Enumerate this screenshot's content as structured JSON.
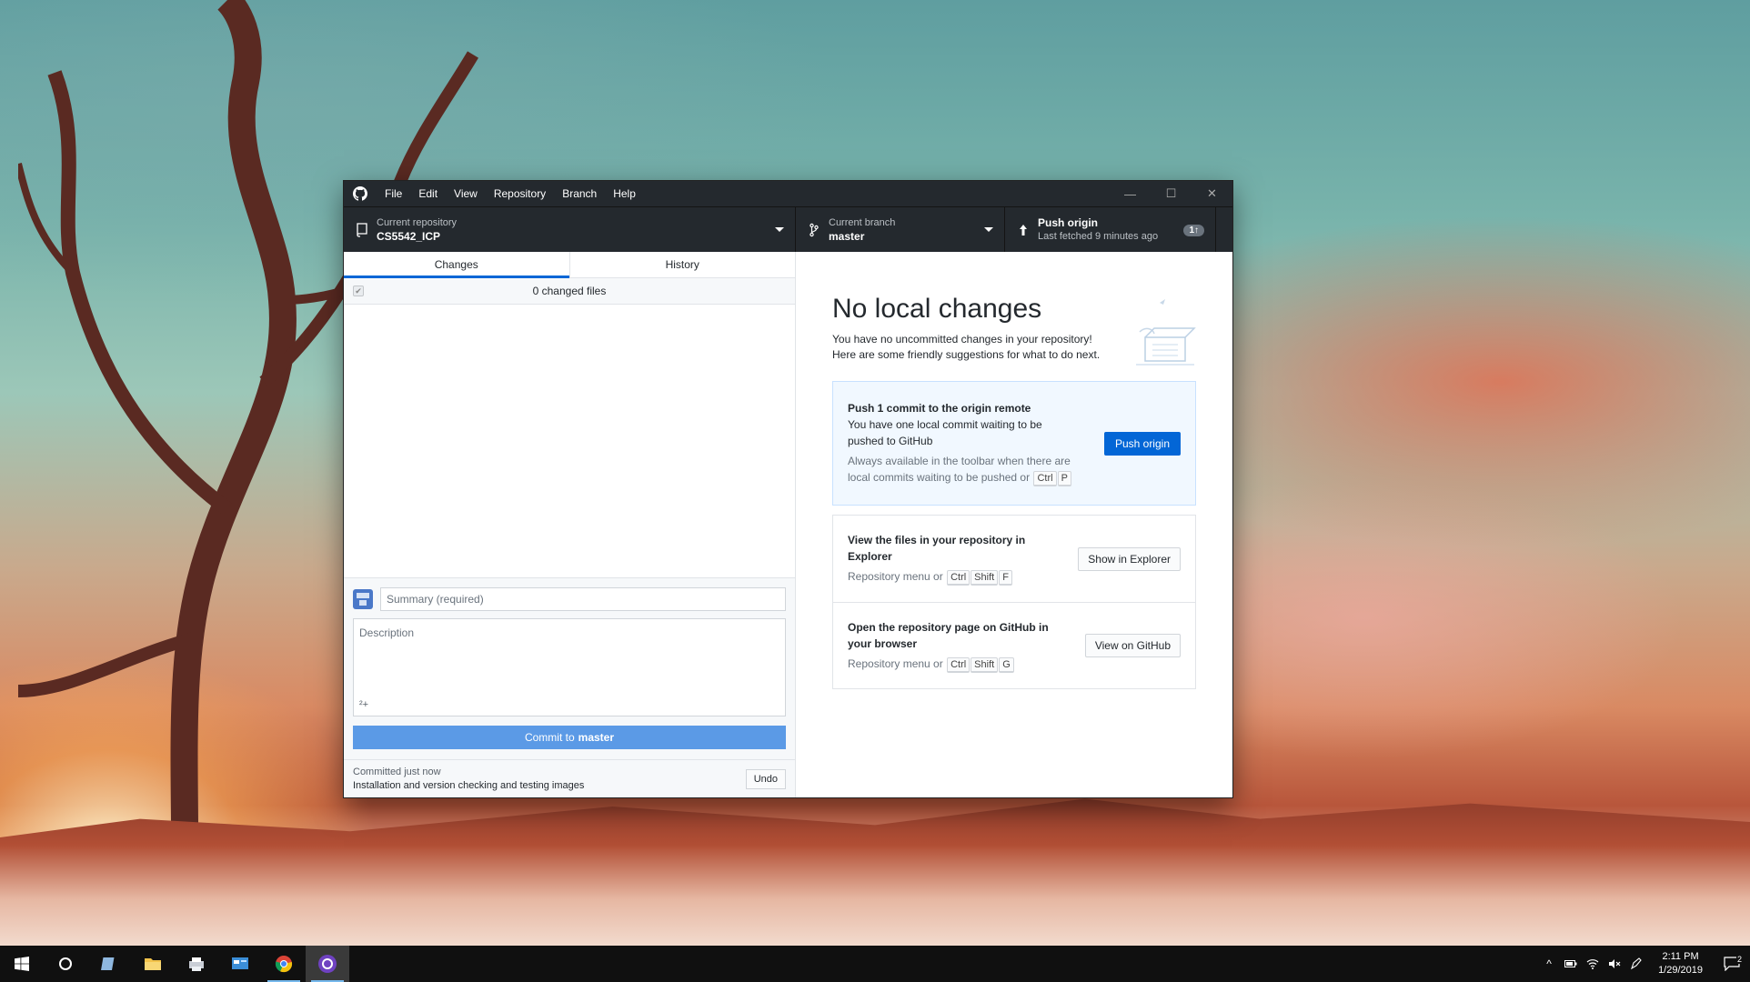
{
  "menu": {
    "items": [
      "File",
      "Edit",
      "View",
      "Repository",
      "Branch",
      "Help"
    ]
  },
  "window_controls": {
    "minimize": "—",
    "maximize": "☐",
    "close": "✕"
  },
  "toolbar": {
    "repo_label": "Current repository",
    "repo_value": "CS5542_ICP",
    "branch_label": "Current branch",
    "branch_value": "master",
    "push_label": "Push origin",
    "push_sub": "Last fetched 9 minutes ago",
    "push_badge": "1↑"
  },
  "tabs": {
    "changes": "Changes",
    "history": "History"
  },
  "changes": {
    "count_text": "0 changed files",
    "checkmark": "✔"
  },
  "commit": {
    "summary_placeholder": "Summary (required)",
    "description_placeholder": "Description",
    "coauthor_icon": "²+",
    "button_prefix": "Commit to",
    "button_branch": "master"
  },
  "last_commit": {
    "when": "Committed just now",
    "message": "Installation and version checking and testing images",
    "undo": "Undo"
  },
  "no_changes": {
    "title": "No local changes",
    "line1": "You have no uncommitted changes in your repository!",
    "line2": "Here are some friendly suggestions for what to do next."
  },
  "push_card": {
    "title": "Push 1 commit to the origin remote",
    "desc1": "You have one local commit waiting to be",
    "desc2": "pushed to GitHub",
    "hint1": "Always available in the toolbar when there are",
    "hint2": "local commits waiting to be pushed or",
    "keys": [
      "Ctrl",
      "P"
    ],
    "button": "Push origin"
  },
  "explorer_card": {
    "title1": "View the files in your repository in",
    "title2": "Explorer",
    "hint": "Repository menu or",
    "keys": [
      "Ctrl",
      "Shift",
      "F"
    ],
    "button": "Show in Explorer"
  },
  "github_card": {
    "title1": "Open the repository page on GitHub in",
    "title2": "your browser",
    "hint": "Repository menu or",
    "keys": [
      "Ctrl",
      "Shift",
      "G"
    ],
    "button": "View on GitHub"
  },
  "taskbar": {
    "time": "2:11 PM",
    "date": "1/29/2019",
    "notification_count": "2"
  },
  "colors": {
    "accent": "#0366d6",
    "toolbar_bg": "#24292e",
    "commit_button": "#5b9ae6"
  }
}
